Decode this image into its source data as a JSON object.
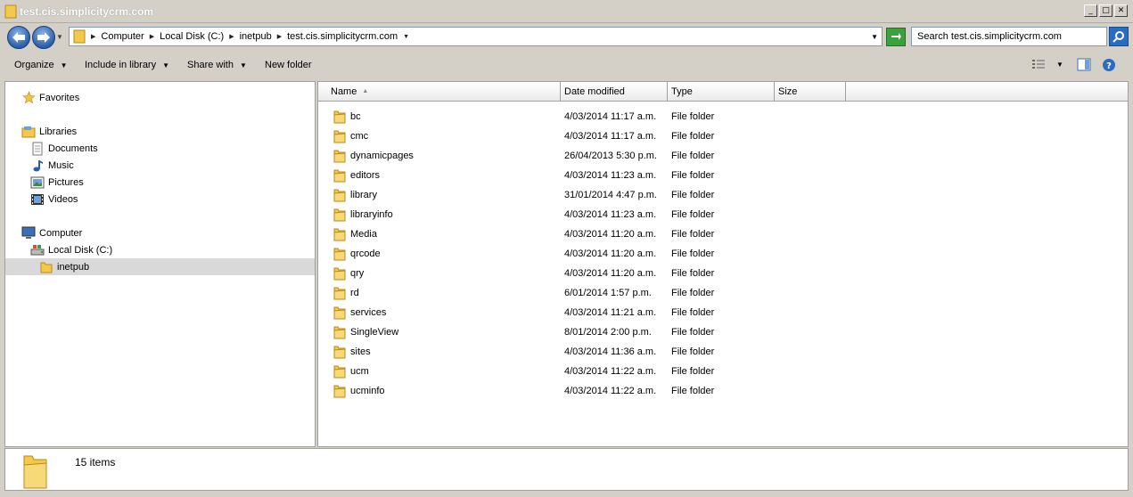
{
  "window": {
    "title": "test.cis.simplicitycrm.com",
    "controls": [
      "minimize-icon",
      "maximize-icon",
      "close-icon"
    ]
  },
  "address": {
    "breadcrumbs": [
      "Computer",
      "Local Disk (C:)",
      "inetpub",
      "test.cis.simplicitycrm.com"
    ],
    "search_placeholder": "Search test.cis.simplicitycrm.com"
  },
  "toolbar": {
    "organize": "Organize",
    "include_in_library": "Include in library",
    "share_with": "Share with",
    "new_folder": "New folder"
  },
  "navpane": {
    "favorites": "Favorites",
    "libraries": "Libraries",
    "documents": "Documents",
    "music": "Music",
    "pictures": "Pictures",
    "videos": "Videos",
    "computer": "Computer",
    "local_disk": "Local Disk (C:)",
    "inetpub": "inetpub"
  },
  "columns": {
    "name": "Name",
    "date_modified": "Date modified",
    "type": "Type",
    "size": "Size"
  },
  "files": [
    {
      "name": "bc",
      "date": "4/03/2014 11:17 a.m.",
      "type": "File folder"
    },
    {
      "name": "cmc",
      "date": "4/03/2014 11:17 a.m.",
      "type": "File folder"
    },
    {
      "name": "dynamicpages",
      "date": "26/04/2013 5:30 p.m.",
      "type": "File folder"
    },
    {
      "name": "editors",
      "date": "4/03/2014 11:23 a.m.",
      "type": "File folder"
    },
    {
      "name": "library",
      "date": "31/01/2014 4:47 p.m.",
      "type": "File folder"
    },
    {
      "name": "libraryinfo",
      "date": "4/03/2014 11:23 a.m.",
      "type": "File folder"
    },
    {
      "name": "Media",
      "date": "4/03/2014 11:20 a.m.",
      "type": "File folder"
    },
    {
      "name": "qrcode",
      "date": "4/03/2014 11:20 a.m.",
      "type": "File folder"
    },
    {
      "name": "qry",
      "date": "4/03/2014 11:20 a.m.",
      "type": "File folder"
    },
    {
      "name": "rd",
      "date": "6/01/2014 1:57 p.m.",
      "type": "File folder"
    },
    {
      "name": "services",
      "date": "4/03/2014 11:21 a.m.",
      "type": "File folder"
    },
    {
      "name": "SingleView",
      "date": "8/01/2014 2:00 p.m.",
      "type": "File folder"
    },
    {
      "name": "sites",
      "date": "4/03/2014 11:36 a.m.",
      "type": "File folder"
    },
    {
      "name": "ucm",
      "date": "4/03/2014 11:22 a.m.",
      "type": "File folder"
    },
    {
      "name": "ucminfo",
      "date": "4/03/2014 11:22 a.m.",
      "type": "File folder"
    }
  ],
  "status": {
    "item_count": "15 items"
  },
  "colors": {
    "folder": "#f2c94c",
    "folder_dark": "#d9a521",
    "selection": "#d9d9d9",
    "nav_button": "#2a5ea8"
  }
}
